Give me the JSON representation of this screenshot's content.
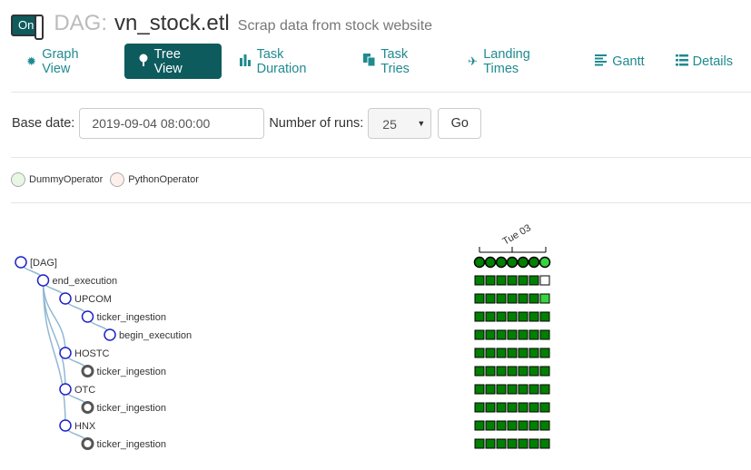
{
  "header": {
    "toggle_label": "On",
    "dag_prefix": "DAG:",
    "dag_id": "vn_stock.etl",
    "description": "Scrap data from stock website"
  },
  "tabs": [
    {
      "label": "Graph View",
      "icon": "gear-icon",
      "active": false
    },
    {
      "label": "Tree View",
      "icon": "tree-icon",
      "active": true
    },
    {
      "label": "Task Duration",
      "icon": "bar-chart-icon",
      "active": false
    },
    {
      "label": "Task Tries",
      "icon": "files-icon",
      "active": false
    },
    {
      "label": "Landing Times",
      "icon": "plane-icon",
      "active": false
    },
    {
      "label": "Gantt",
      "icon": "align-left-icon",
      "active": false
    },
    {
      "label": "Details",
      "icon": "list-icon",
      "active": false
    }
  ],
  "controls": {
    "base_date_label": "Base date:",
    "base_date_value": "2019-09-04 08:00:00",
    "num_runs_label": "Number of runs:",
    "num_runs_value": "25",
    "go_label": "Go"
  },
  "legend": [
    {
      "label": "DummyOperator",
      "color": "#e8f7e4"
    },
    {
      "label": "PythonOperator",
      "color": "#ffefeb"
    }
  ],
  "date_axis_label": "Tue 03",
  "colors": {
    "success": "#008000",
    "success_light": "#37d43f",
    "none": "#ffffff",
    "tree_link": "#91b8d4",
    "node_blue": "#1d22c9",
    "node_dark": "#555555"
  },
  "tree_nodes": [
    {
      "label": "[DAG]",
      "depth": 0,
      "style": "blue",
      "runs": [
        "success",
        "success",
        "success",
        "success",
        "success",
        "success",
        "success_light"
      ],
      "run_shape": "circle"
    },
    {
      "label": "end_execution",
      "depth": 1,
      "style": "blue",
      "runs": [
        "success",
        "success",
        "success",
        "success",
        "success",
        "success",
        "none"
      ],
      "run_shape": "square"
    },
    {
      "label": "UPCOM",
      "depth": 2,
      "style": "blue",
      "runs": [
        "success",
        "success",
        "success",
        "success",
        "success",
        "success",
        "success_light"
      ],
      "run_shape": "square"
    },
    {
      "label": "ticker_ingestion",
      "depth": 3,
      "style": "blue",
      "runs": [
        "success",
        "success",
        "success",
        "success",
        "success",
        "success",
        "success"
      ],
      "run_shape": "square"
    },
    {
      "label": "begin_execution",
      "depth": 4,
      "style": "blue",
      "runs": [
        "success",
        "success",
        "success",
        "success",
        "success",
        "success",
        "success"
      ],
      "run_shape": "square"
    },
    {
      "label": "HOSTC",
      "depth": 2,
      "style": "blue",
      "runs": [
        "success",
        "success",
        "success",
        "success",
        "success",
        "success",
        "success"
      ],
      "run_shape": "square"
    },
    {
      "label": "ticker_ingestion",
      "depth": 3,
      "style": "dark",
      "runs": [
        "success",
        "success",
        "success",
        "success",
        "success",
        "success",
        "success"
      ],
      "run_shape": "square"
    },
    {
      "label": "OTC",
      "depth": 2,
      "style": "blue",
      "runs": [
        "success",
        "success",
        "success",
        "success",
        "success",
        "success",
        "success"
      ],
      "run_shape": "square"
    },
    {
      "label": "ticker_ingestion",
      "depth": 3,
      "style": "dark",
      "runs": [
        "success",
        "success",
        "success",
        "success",
        "success",
        "success",
        "success"
      ],
      "run_shape": "square"
    },
    {
      "label": "HNX",
      "depth": 2,
      "style": "blue",
      "runs": [
        "success",
        "success",
        "success",
        "success",
        "success",
        "success",
        "success"
      ],
      "run_shape": "square"
    },
    {
      "label": "ticker_ingestion",
      "depth": 3,
      "style": "dark",
      "runs": [
        "success",
        "success",
        "success",
        "success",
        "success",
        "success",
        "success"
      ],
      "run_shape": "square"
    }
  ]
}
